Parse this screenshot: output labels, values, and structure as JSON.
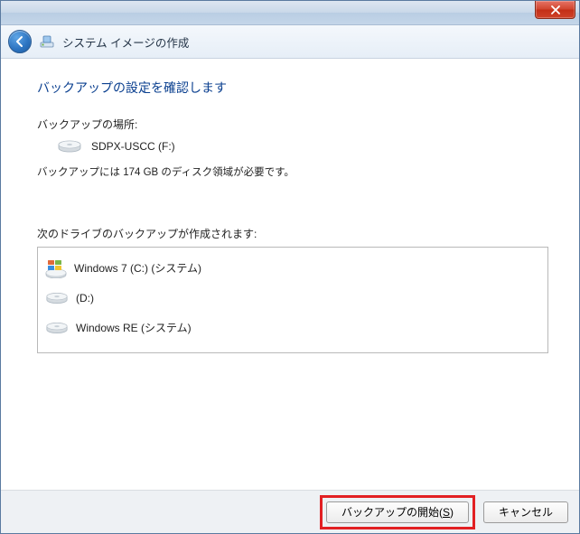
{
  "titlebar": {},
  "header": {
    "title": "システム イメージの作成"
  },
  "content": {
    "heading": "バックアップの設定を確認します",
    "location_label": "バックアップの場所:",
    "location_value": "SDPX-USCC (F:)",
    "space_required": "バックアップには 174 GB のディスク領域が必要です。",
    "drives_label": "次のドライブのバックアップが作成されます:",
    "drives": [
      {
        "name": "Windows 7 (C:) (システム)"
      },
      {
        "name": "(D:)"
      },
      {
        "name": "Windows RE (システム)"
      }
    ]
  },
  "footer": {
    "primary_prefix": "バックアップの開始(",
    "primary_key": "S",
    "primary_suffix": ")",
    "cancel": "キャンセル"
  }
}
